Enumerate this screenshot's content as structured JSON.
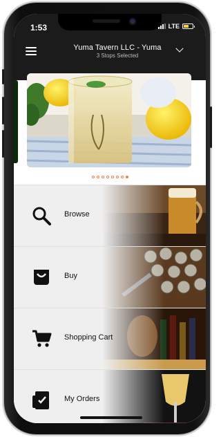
{
  "status_bar": {
    "time": "1:53",
    "network": "LTE"
  },
  "header": {
    "store_name": "Yuma Tavern LLC - Yuma",
    "stops_selected": "3 Stops Selected"
  },
  "carousel": {
    "slide_count": 8,
    "active_index": 7
  },
  "menu": [
    {
      "label": "Browse",
      "icon": "search-icon"
    },
    {
      "label": "Buy",
      "icon": "bag-icon"
    },
    {
      "label": "Shopping Cart",
      "icon": "cart-icon"
    },
    {
      "label": "My Orders",
      "icon": "clipboard-icon"
    }
  ],
  "colors": {
    "header_bg": "#1b1b1b",
    "accent": "#e4834b",
    "row_bg": "#efefef"
  }
}
